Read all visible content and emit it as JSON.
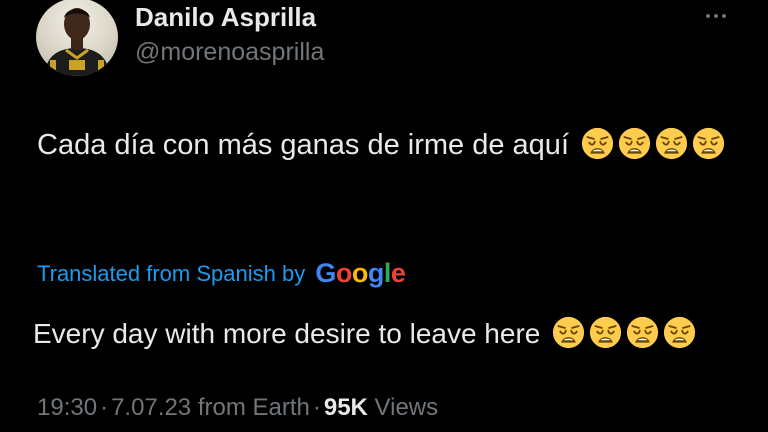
{
  "author": {
    "display_name": "Danilo Asprilla",
    "handle": "@morenoasprilla"
  },
  "tweet": {
    "text": "Cada día con más ganas de irme de aquí",
    "emoji": "weary-face",
    "emoji_count": 4
  },
  "translation": {
    "label": "Translated from Spanish by",
    "provider_letters": [
      "G",
      "o",
      "o",
      "g",
      "l",
      "e"
    ],
    "provider_colors": [
      "#4285F4",
      "#EA4335",
      "#FBBC05",
      "#4285F4",
      "#34A853",
      "#EA4335"
    ],
    "text": "Every day with more desire to leave here",
    "emoji_count": 4
  },
  "meta": {
    "time": "19:30",
    "date": "7.07.23",
    "source": "from Earth",
    "views_count": "95K",
    "views_label": "Views"
  },
  "colors": {
    "background": "#000000",
    "primary_text": "#e7e9ea",
    "secondary_text": "#71767b",
    "link": "#1d9bf0"
  },
  "icons": {
    "more": "more-horizontal-icon"
  }
}
